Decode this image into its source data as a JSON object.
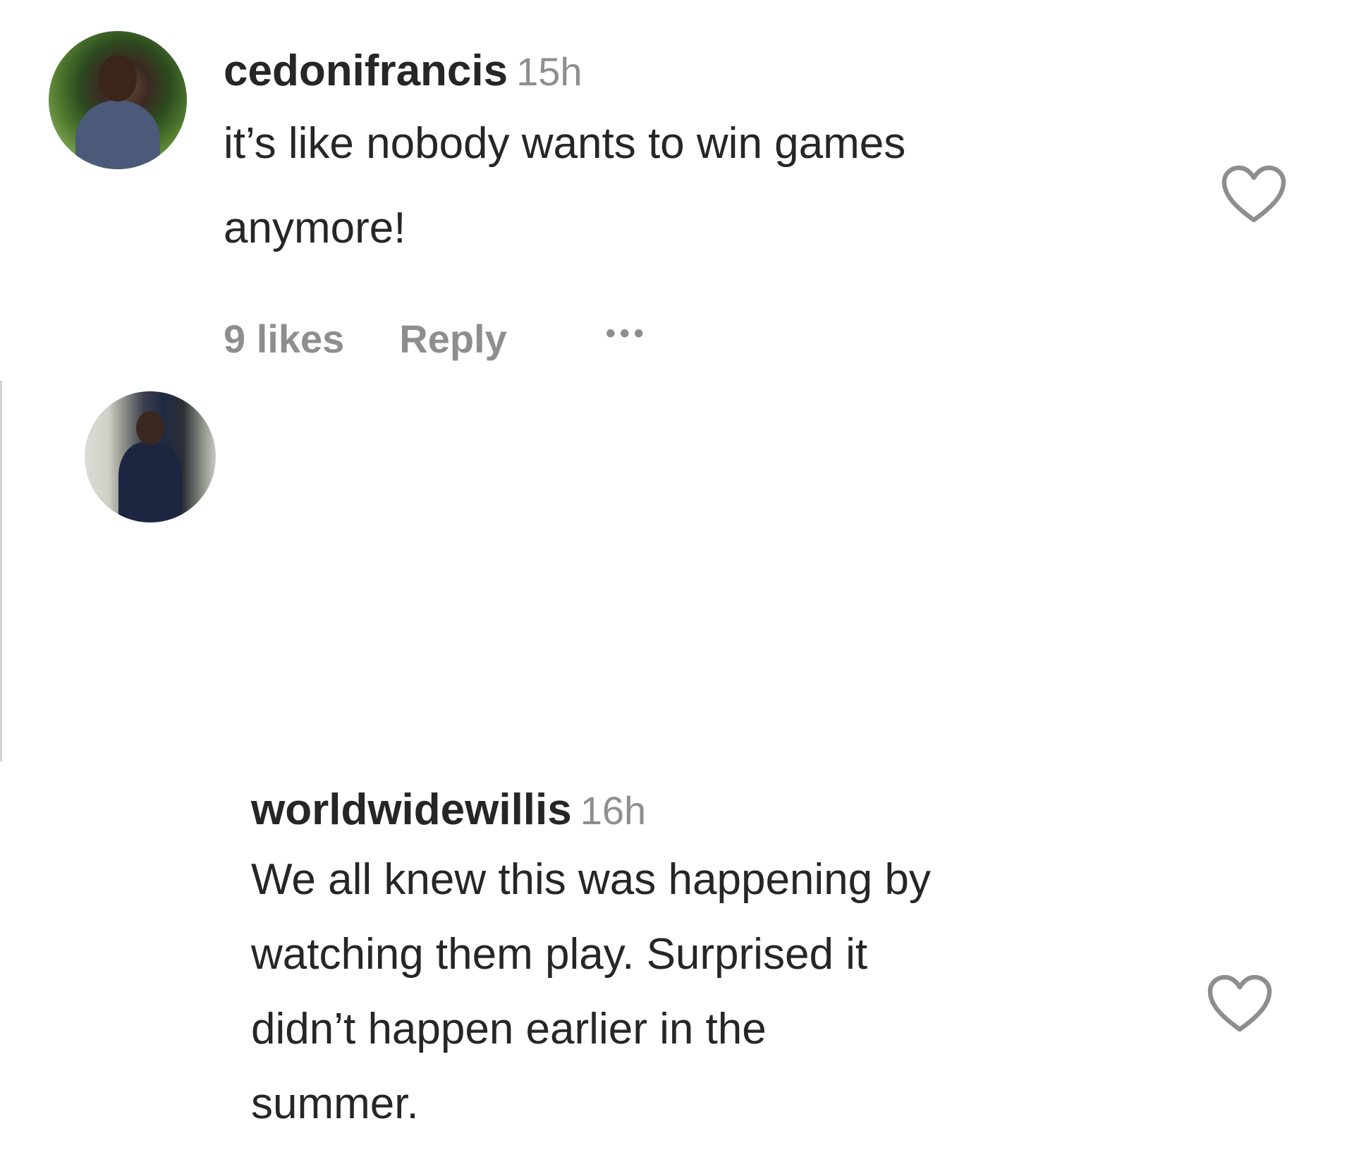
{
  "comments": [
    {
      "username": "cedonifrancis",
      "time": "15h",
      "text_lines": [
        "it’s like nobody wants to win games",
        "anymore!"
      ],
      "likes": "9 likes",
      "reply_label": "Reply",
      "more_label": "•••",
      "liked": false
    },
    {
      "username": "worldwidewillis",
      "time": "16h",
      "text_lines": [
        "We all knew this was happening by",
        "watching them play. Surprised it",
        "didn’t happen earlier in the",
        "summer."
      ],
      "liked": false
    }
  ],
  "icons": {
    "like": "heart-outline-icon",
    "more": "more-options-icon"
  },
  "colors": {
    "text": "#262626",
    "muted": "#8e8e8e",
    "background": "#ffffff"
  }
}
